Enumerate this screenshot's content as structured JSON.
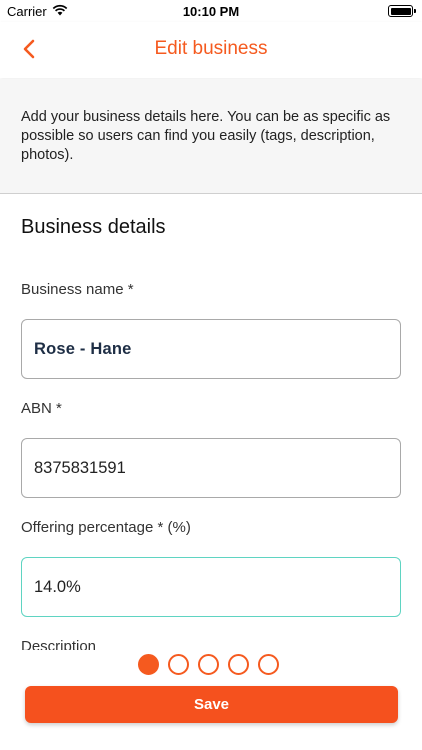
{
  "status_bar": {
    "carrier": "Carrier",
    "time": "10:10 PM"
  },
  "nav": {
    "title": "Edit business",
    "accent_color": "#f55a1f"
  },
  "intro": {
    "text": "Add your business details here. You can be as specific as possible so users can find you easily (tags, description, photos)."
  },
  "form": {
    "section_title": "Business details",
    "business_name": {
      "label": "Business name *",
      "value": "Rose - Hane"
    },
    "abn": {
      "label": "ABN *",
      "value": "8375831591"
    },
    "offering": {
      "label": "Offering percentage * (%)",
      "value": "14.0%"
    },
    "description": {
      "label": "Description"
    }
  },
  "pagination": {
    "total": 5,
    "active_index": 0
  },
  "actions": {
    "save_label": "Save"
  },
  "icons": {
    "back": "chevron-left-icon",
    "wifi": "wifi-icon",
    "battery": "battery-icon"
  }
}
